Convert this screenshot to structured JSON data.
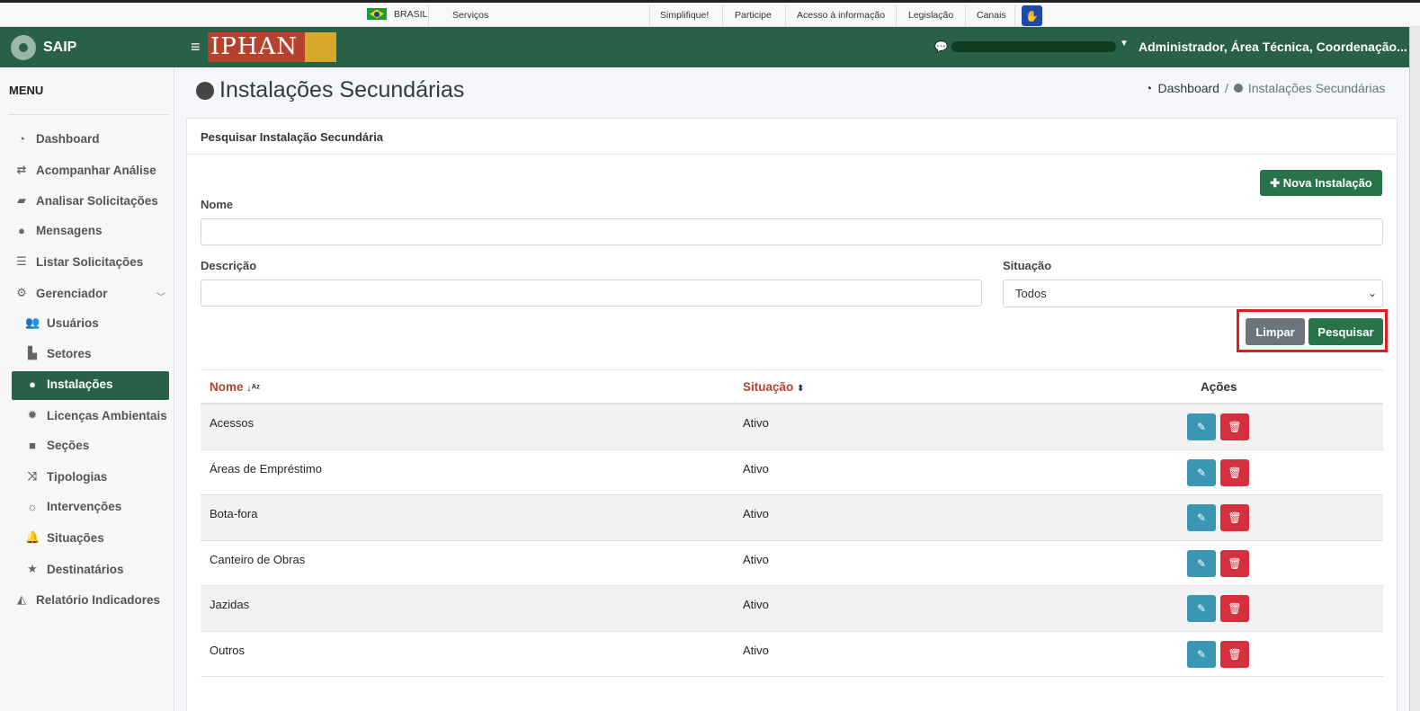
{
  "govbar": {
    "country": "BRASIL",
    "links": [
      "Serviços",
      "Simplifique!",
      "Participe",
      "Acesso à informação",
      "Legislação",
      "Canais"
    ]
  },
  "app": {
    "name": "SAIP",
    "logo_text": "IPHAN",
    "user": "Administrador, Área Técnica, Coordenação..."
  },
  "sidebar": {
    "title": "MENU",
    "items": [
      {
        "label": "Dashboard",
        "icon": "dashboard-icon"
      },
      {
        "label": "Acompanhar Análise",
        "icon": "exchange-icon"
      },
      {
        "label": "Analisar Solicitações",
        "icon": "book-icon"
      },
      {
        "label": "Mensagens",
        "icon": "comments-icon"
      },
      {
        "label": "Listar Solicitações",
        "icon": "list-icon"
      },
      {
        "label": "Gerenciador",
        "icon": "cogs-icon"
      },
      {
        "label": "Usuários",
        "icon": "users-icon"
      },
      {
        "label": "Setores",
        "icon": "industry-icon"
      },
      {
        "label": "Instalações",
        "icon": "circle-icon"
      },
      {
        "label": "Licenças Ambientais",
        "icon": "certificate-icon"
      },
      {
        "label": "Seções",
        "icon": "square-icon"
      },
      {
        "label": "Tipologias",
        "icon": "random-icon"
      },
      {
        "label": "Intervenções",
        "icon": "sun-icon"
      },
      {
        "label": "Situações",
        "icon": "bell-icon"
      },
      {
        "label": "Destinatários",
        "icon": "star-icon"
      },
      {
        "label": "Relatório Indicadores",
        "icon": "area-chart-icon"
      }
    ]
  },
  "page": {
    "title": "Instalações Secundárias",
    "breadcrumb": [
      "Dashboard",
      "/",
      "Instalações Secundárias"
    ]
  },
  "search": {
    "header": "Pesquisar Instalação Secundária",
    "new_button": "Nova Instalação",
    "name_label": "Nome",
    "name_value": "",
    "desc_label": "Descrição",
    "desc_value": "",
    "status_label": "Situação",
    "status_value": "Todos",
    "clear_button": "Limpar",
    "search_button": "Pesquisar"
  },
  "table": {
    "headers": [
      "Nome",
      "Situação",
      "Ações"
    ],
    "rows": [
      {
        "nome": "Acessos",
        "situacao": "Ativo"
      },
      {
        "nome": "Áreas de Empréstimo",
        "situacao": "Ativo"
      },
      {
        "nome": "Bota-fora",
        "situacao": "Ativo"
      },
      {
        "nome": "Canteiro de Obras",
        "situacao": "Ativo"
      },
      {
        "nome": "Jazidas",
        "situacao": "Ativo"
      },
      {
        "nome": "Outros",
        "situacao": "Ativo"
      }
    ]
  }
}
